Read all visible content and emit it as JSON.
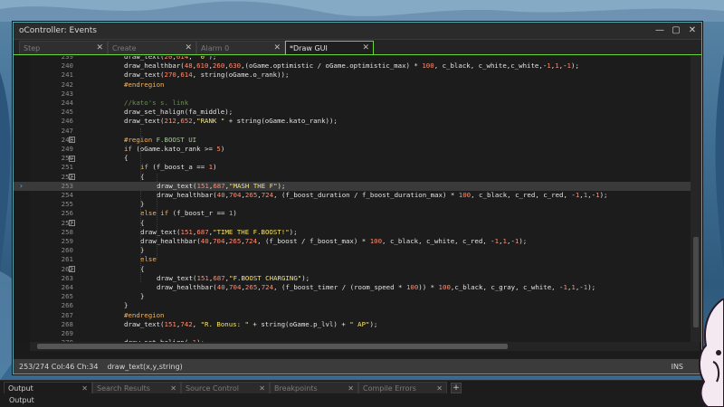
{
  "window": {
    "title": "oController: Events",
    "controls": [
      "minimize-icon",
      "maximize-icon",
      "close-icon"
    ]
  },
  "tabs": [
    {
      "label": "Step",
      "active": false
    },
    {
      "label": "Create",
      "active": false
    },
    {
      "label": "Alarm 0",
      "active": false
    },
    {
      "label": "*Draw GUI",
      "active": true
    }
  ],
  "code_lines": [
    {
      "num": 239,
      "indent": 3,
      "text": "draw_text(20,614, \"0\");"
    },
    {
      "num": 240,
      "indent": 3,
      "text": "draw_healthbar(48,610,260,630,(oGame.optimistic / oGame.optimistic_max) * 100, c_black, c_white,c_white,-1,1,-1);"
    },
    {
      "num": 241,
      "indent": 3,
      "text": "draw_text(270,614, string(oGame.o_rank));"
    },
    {
      "num": 242,
      "indent": 3,
      "text": "#endregion"
    },
    {
      "num": 243,
      "indent": 3,
      "text": ""
    },
    {
      "num": 244,
      "indent": 3,
      "text": "//kato's s. link"
    },
    {
      "num": 245,
      "indent": 3,
      "text": "draw_set_halign(fa_middle);"
    },
    {
      "num": 246,
      "indent": 3,
      "text": "draw_text(212,652,\"RANK \" + string(oGame.kato_rank));"
    },
    {
      "num": 247,
      "indent": 3,
      "text": ""
    },
    {
      "num": 248,
      "indent": 3,
      "text": "#region F.BOOST UI",
      "fold": true
    },
    {
      "num": 249,
      "indent": 3,
      "text": "if (oGame.kato_rank >= 5)"
    },
    {
      "num": 250,
      "indent": 3,
      "text": "{",
      "fold": true
    },
    {
      "num": 251,
      "indent": 4,
      "text": "if (f_boost_a == 1)"
    },
    {
      "num": 252,
      "indent": 4,
      "text": "{",
      "fold": true
    },
    {
      "num": 253,
      "indent": 5,
      "text": "draw_text(151,687,\"MASH THE F\");",
      "current": true
    },
    {
      "num": 254,
      "indent": 5,
      "text": "draw_healthbar(40,704,265,724, (f_boost_duration / f_boost_duration_max) * 100, c_black, c_red, c_red, -1,1,-1);"
    },
    {
      "num": 255,
      "indent": 4,
      "text": "}"
    },
    {
      "num": 256,
      "indent": 4,
      "text": "else if (f_boost_r == 1)"
    },
    {
      "num": 257,
      "indent": 4,
      "text": "{",
      "fold": true
    },
    {
      "num": 258,
      "indent": 4,
      "text": "draw_text(151,687,\"TIME THE F.BOOST!\");"
    },
    {
      "num": 259,
      "indent": 4,
      "text": "draw_healthbar(40,704,265,724, (f_boost / f_boost_max) * 100, c_black, c_white, c_red, -1,1,-1);"
    },
    {
      "num": 260,
      "indent": 4,
      "text": "}"
    },
    {
      "num": 261,
      "indent": 4,
      "text": "else"
    },
    {
      "num": 262,
      "indent": 4,
      "text": "{",
      "fold": true
    },
    {
      "num": 263,
      "indent": 5,
      "text": "draw_text(151,687,\"F.BOOST CHARGING\");"
    },
    {
      "num": 264,
      "indent": 5,
      "text": "draw_healthbar(40,704,265,724, (f_boost_timer / (room_speed * 100)) * 100,c_black, c_gray, c_white, -1,1,-1);"
    },
    {
      "num": 265,
      "indent": 4,
      "text": "}"
    },
    {
      "num": 266,
      "indent": 3,
      "text": "}"
    },
    {
      "num": 267,
      "indent": 3,
      "text": "#endregion"
    },
    {
      "num": 268,
      "indent": 3,
      "text": "draw_text(151,742, \"R. Bonus: \" + string(oGame.p_lvl) + \" AP\");"
    },
    {
      "num": 269,
      "indent": 3,
      "text": ""
    },
    {
      "num": 270,
      "indent": 3,
      "text": "draw_set_halign(-1);"
    }
  ],
  "status": {
    "position": "253/274 Col:46 Ch:34",
    "signature": "draw_text(x,y,string)",
    "mode": "INS"
  },
  "bottom_tabs": [
    {
      "label": "Output",
      "active": true
    },
    {
      "label": "Search Results",
      "active": false
    },
    {
      "label": "Source Control",
      "active": false
    },
    {
      "label": "Breakpoints",
      "active": false
    },
    {
      "label": "Compile Errors",
      "active": false
    }
  ],
  "bottom_output_label": "Output",
  "colors": {
    "accent_green": "#6bd63a",
    "window_border": "#5ea6a8",
    "current_line": "#3a3a3a",
    "string": "#f7e36a",
    "number": "#ff8c72",
    "keyword": "#f3b35e",
    "comment": "#6b8f55"
  }
}
